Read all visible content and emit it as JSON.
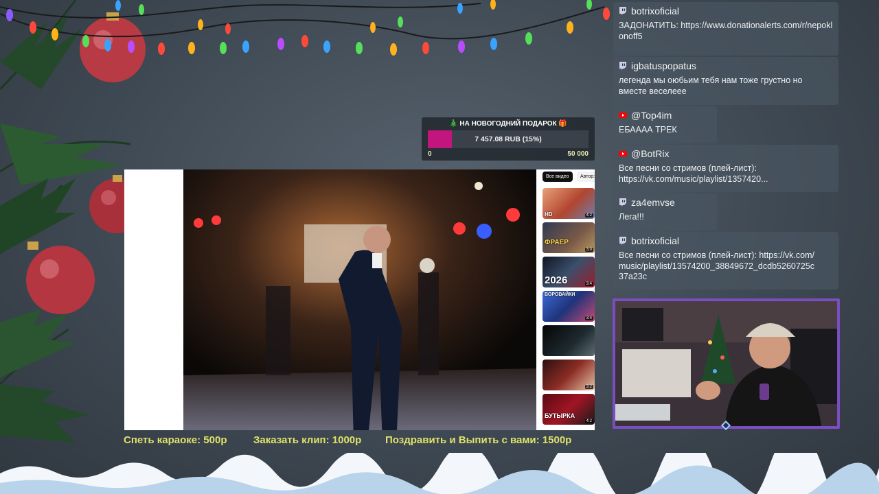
{
  "donation_goal": {
    "title": "🎄 НА НОВОГОДНИЙ ПОДАРОК 🎁",
    "amount_label": "7 457.08 RUB (15%)",
    "progress_fraction": 0.15,
    "min_label": "0",
    "max_label": "50 000",
    "fill_color": "#c2157e"
  },
  "player": {
    "chips": [
      "Все видео",
      "Автор:"
    ],
    "thumbnails": [
      {
        "badge": "HD",
        "duration": "4:2",
        "title": ""
      },
      {
        "badge": "",
        "duration": "3:0",
        "title": "ФРАЕР"
      },
      {
        "badge": "",
        "duration": "3:4",
        "title": "2026"
      },
      {
        "badge": "",
        "duration": "3:4",
        "title": "ВОРОВАЙКИ"
      },
      {
        "badge": "",
        "duration": "",
        "title": ""
      },
      {
        "badge": "",
        "duration": "3:2",
        "title": ""
      },
      {
        "badge": "",
        "duration": "4:2",
        "title": "БУТЫРКА"
      }
    ]
  },
  "prices": [
    "Спеть караоке: 500р",
    "Заказать клип: 1000р",
    "Поздравить и Выпить с вами: 1500р"
  ],
  "chat": [
    {
      "platform": "twitch-icon",
      "author": "botrixoficial",
      "text": "ЗАДОНАТИТЬ: https://www.donationalerts.com/r/nepoklonoff5"
    },
    {
      "platform": "twitch-icon",
      "author": "igbatuspopatus",
      "text": "легенда мы оюбьим тебя нам тоже грустно но вместе веселеее"
    },
    {
      "platform": "youtube-icon",
      "author": "@Top4im",
      "text": "ЕБАААА ТРЕК"
    },
    {
      "platform": "youtube-icon",
      "author": "@BotRix",
      "text": "Все песни со стримов (плей-лист): https://vk.com/music/playlist/1357420..."
    },
    {
      "platform": "twitch-icon",
      "author": "za4emvse",
      "text": "Лега!!!"
    },
    {
      "platform": "twitch-icon",
      "author": "botrixoficial",
      "text": "Все песни со стримов (плей-лист): https://vk.com/music/playlist/13574200_38849672_dcdb5260725c37a23c"
    }
  ],
  "colors": {
    "price_text": "#dfe26a",
    "twitch": "#9146ff",
    "youtube": "#ff0000",
    "webcam_border": "#7a4ec1"
  }
}
